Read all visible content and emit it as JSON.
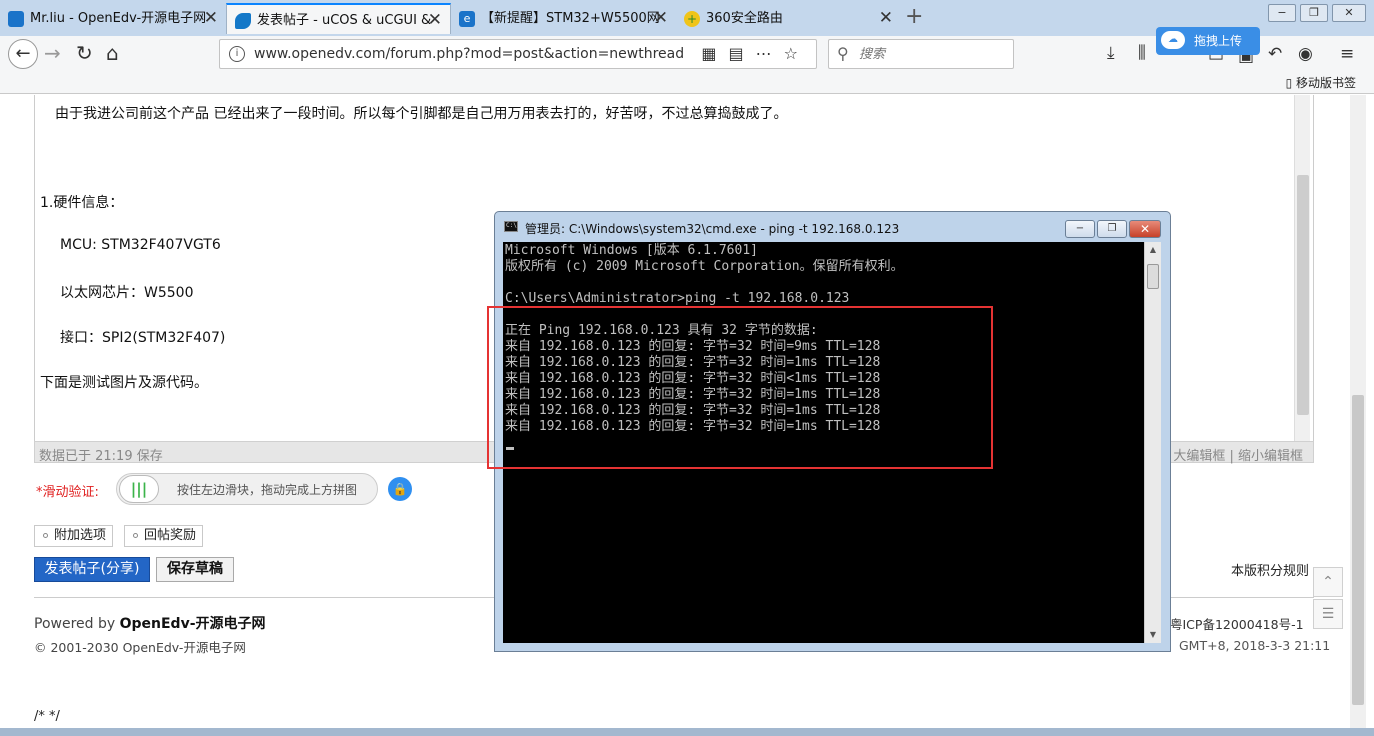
{
  "tabs": [
    {
      "label": "Mr.liu - OpenEdv-开源电子网",
      "icon_color": "#1a73c9",
      "active": false
    },
    {
      "label": "发表帖子 - uCOS & uCGUI & ",
      "icon_color": "#1478c8",
      "active": true
    },
    {
      "label": "【新提醒】STM32+W5500网",
      "icon_color": "#1a73c9",
      "active": false
    },
    {
      "label": "360安全路由",
      "icon_color": "#f0c419",
      "active": false
    }
  ],
  "window_buttons": {
    "min": "−",
    "max": "❐",
    "close": "✕"
  },
  "nav": {
    "url": "www.openedv.com/forum.php?mod=post&action=newthread",
    "search_placeholder": "搜索",
    "upload_label": "拖拽上传",
    "mobile_bookmarks": "移动版书签"
  },
  "post": {
    "intro_line": "由于我进公司前这个产品 已经出来了一段时间。所以每个引脚都是自己用万用表去打的，好苦呀，不过总算捣鼓成了。",
    "hw_title": "1.硬件信息：",
    "mcu": "MCU:  STM32F407VGT6",
    "eth": "以太网芯片：W5500",
    "iface": "接口：SPI2(STM32F407)",
    "below": "下面是测试图片及源代码。"
  },
  "editor_status": {
    "saved": "数据已于 21:19 保存",
    "resize": "大编辑框 | 缩小编辑框"
  },
  "captcha": {
    "label": "*滑动验证:",
    "hint": "按住左边滑块，拖动完成上方拼图"
  },
  "options": {
    "extra": "附加选项",
    "reward": "回帖奖励"
  },
  "buttons": {
    "submit": "发表帖子(分享)",
    "save_draft": "保存草稿"
  },
  "footer": {
    "rules": "本版积分规则",
    "powered_prefix": "Powered by ",
    "powered_name": "OpenEdv-开源电子网",
    "copyright": "© 2001-2030 OpenEdv-开源电子网",
    "icp": "粤ICP备12000418号-1",
    "gmt": "GMT+8, 2018-3-3 21:11",
    "js_comment": "/* */"
  },
  "cmd": {
    "title": "管理员: C:\\Windows\\system32\\cmd.exe - ping  -t 192.168.0.123",
    "lines": [
      "Microsoft Windows [版本 6.1.7601]",
      "版权所有 (c) 2009 Microsoft Corporation。保留所有权利。",
      "",
      "C:\\Users\\Administrator>ping -t 192.168.0.123",
      "",
      "正在 Ping 192.168.0.123 具有 32 字节的数据:",
      "来自 192.168.0.123 的回复: 字节=32 时间=9ms TTL=128",
      "来自 192.168.0.123 的回复: 字节=32 时间=1ms TTL=128",
      "来自 192.168.0.123 的回复: 字节=32 时间<1ms TTL=128",
      "来自 192.168.0.123 的回复: 字节=32 时间=1ms TTL=128",
      "来自 192.168.0.123 的回复: 字节=32 时间=1ms TTL=128",
      "来自 192.168.0.123 的回复: 字节=32 时间=1ms TTL=128"
    ]
  },
  "colors": {
    "highlight_box": "#e53333",
    "submit_button": "#2366c6",
    "captcha_label": "#e02020"
  }
}
